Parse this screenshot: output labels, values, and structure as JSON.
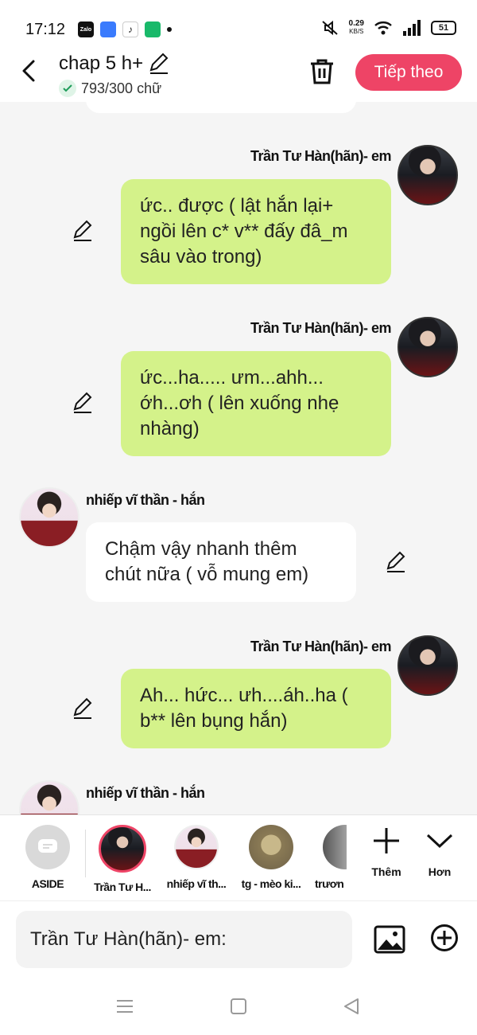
{
  "status_bar": {
    "time": "17:12",
    "speed_value": "0.29",
    "speed_unit": "KB/S",
    "battery": "51"
  },
  "header": {
    "title": "chap 5 h+",
    "word_count": "793/300 chữ",
    "next_button": "Tiếp theo"
  },
  "messages": [
    {
      "sender": "Trần Tư Hàn(hãn)- em",
      "side": "right",
      "text": "ức.. được ( lật hắn lại+ ngồi lên c* v** đấy đâ_m sâu vào trong)"
    },
    {
      "sender": "Trần Tư Hàn(hãn)- em",
      "side": "right",
      "text": "ức...ha..... ưm...ahh... ớh...ơh ( lên xuống nhẹ nhàng)"
    },
    {
      "sender": "nhiếp vĩ thần - hắn",
      "side": "left",
      "text": "Chậm vậy nhanh thêm chút nữa ( vỗ mung em)"
    },
    {
      "sender": "Trần Tư Hàn(hãn)- em",
      "side": "right",
      "text": "Ah... hức... ưh....áh..ha ( b** lên bụng hắn)"
    },
    {
      "sender": "nhiếp vĩ thần - hắn",
      "side": "left",
      "text": ""
    }
  ],
  "characters": [
    {
      "label": "ASIDE"
    },
    {
      "label": "Trần Tư H..."
    },
    {
      "label": "nhiếp vĩ th..."
    },
    {
      "label": "tg - mèo ki..."
    },
    {
      "label": "trươn"
    }
  ],
  "tools": {
    "add_label": "Thêm",
    "more_label": "Hơn"
  },
  "input": {
    "placeholder": "Trần Tư Hàn(hãn)- em:"
  },
  "colors": {
    "accent": "#ee4466",
    "bubble_green": "#d4f28a",
    "bubble_white": "#ffffff",
    "background": "#f5f5f5"
  }
}
